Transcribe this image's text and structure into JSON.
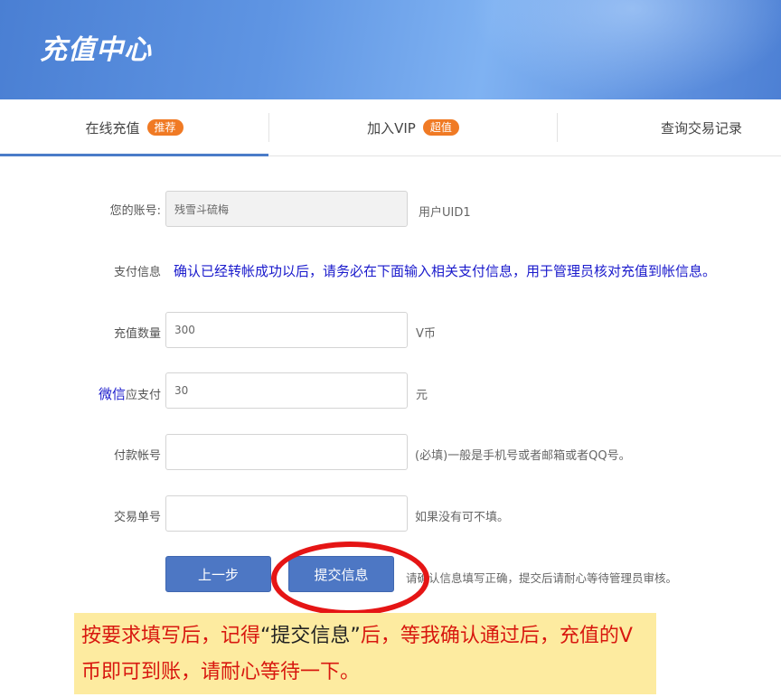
{
  "header": {
    "title": "充值中心"
  },
  "tabs": [
    {
      "label": "在线充值",
      "badge": "推荐",
      "active": true
    },
    {
      "label": "加入VIP",
      "badge": "超值",
      "active": false
    },
    {
      "label": "查询交易记录",
      "badge": "",
      "active": false
    }
  ],
  "form": {
    "account": {
      "label": "您的账号:",
      "value": "残雪斗硫梅",
      "hint": "用户UID1"
    },
    "payment_info": {
      "label": "支付信息",
      "note": "确认已经转帐成功以后，请务必在下面输入相关支付信息，用于管理员核对充值到帐信息。"
    },
    "quantity": {
      "label": "充值数量",
      "value": "300",
      "unit": "V币"
    },
    "amount": {
      "method": "微信",
      "label": "应支付",
      "value": "30",
      "unit": "元"
    },
    "pay_account": {
      "label": "付款帐号",
      "value": "",
      "hint": "(必填)一般是手机号或者邮箱或者QQ号。"
    },
    "trade_no": {
      "label": "交易单号",
      "value": "",
      "hint": "如果没有可不填。"
    }
  },
  "actions": {
    "prev_label": "上一步",
    "submit_label": "提交信息",
    "confirm_hint": "请确认信息填写正确，提交后请耐心等待管理员审核。"
  },
  "callout": {
    "part1": "按要求填写后，记得",
    "highlight": "“提交信息”",
    "part2": "后，等我确认通过后，充值的V币即可到账，请耐心等待一下。"
  },
  "colors": {
    "accent": "#4b7cc9",
    "badge": "#f07a24",
    "note_blue": "#1a1acc",
    "annotation_red": "#e51515",
    "callout_bg": "#fdeba0"
  }
}
